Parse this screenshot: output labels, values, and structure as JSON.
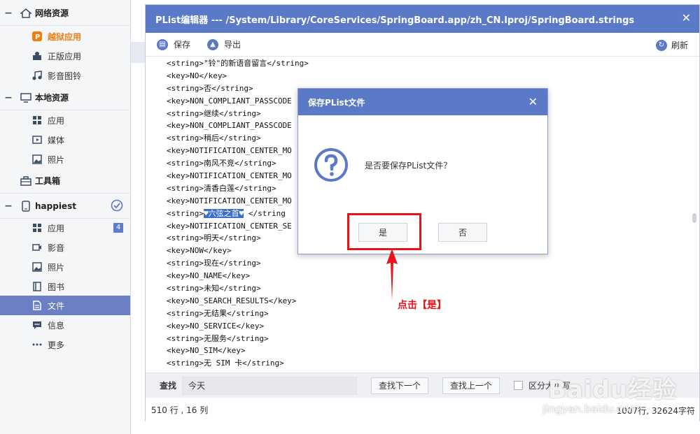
{
  "sidebar": {
    "groups": [
      {
        "label": "网络资源",
        "icon": "home-icon"
      },
      {
        "label": "本地资源",
        "icon": "monitor-icon"
      },
      {
        "label": "工具箱",
        "icon": "toolbox-icon"
      },
      {
        "label": "happiest",
        "icon": "phone-icon"
      }
    ],
    "network_items": [
      {
        "label": "越狱应用",
        "icon": "jailbreak-app-icon"
      },
      {
        "label": "正版应用",
        "icon": "genuine-app-icon"
      },
      {
        "label": "影音图铃",
        "icon": "music-icon"
      }
    ],
    "local_items": [
      {
        "label": "应用",
        "icon": "apps-grid-icon"
      },
      {
        "label": "媒体",
        "icon": "media-icon"
      },
      {
        "label": "照片",
        "icon": "photo-icon"
      }
    ],
    "device_items": [
      {
        "label": "应用",
        "icon": "apps-grid-icon",
        "badge": "4"
      },
      {
        "label": "影音",
        "icon": "video-icon"
      },
      {
        "label": "照片",
        "icon": "photo-icon"
      },
      {
        "label": "图书",
        "icon": "book-icon"
      },
      {
        "label": "文件",
        "icon": "file-icon"
      },
      {
        "label": "信息",
        "icon": "message-icon"
      },
      {
        "label": "更多",
        "icon": "more-icon"
      }
    ]
  },
  "editor": {
    "title": "PList编辑器 --- /System/Library/CoreServices/SpringBoard.app/zh_CN.lproj/SpringBoard.strings",
    "toolbar": {
      "save": "保存",
      "export": "导出",
      "refresh": "刷新"
    },
    "lines": [
      "<string>\"铃\"的新语音留言</string>",
      "<key>NO</key>",
      "<string>否</string>",
      "<key>NON_COMPLIANT_PASSCODE",
      "<string>继续</string>",
      "<key>NON_COMPLIANT_PASSCODE",
      "<string>稍后</string>",
      "<key>NOTIFICATION_CENTER_MO",
      "<string>南风不竞</string>",
      "<key>NOTIFICATION_CENTER_MO",
      "<string>清香白莲</string>",
      "<key>NOTIFICATION_CENTER_MO",
      "<key>NOTIFICATION_CENTER_SE",
      "<string>明天</string>",
      "<key>NOW</key>",
      "<string>现在</string>",
      "<key>NO_NAME</key>",
      "<string>未知</string>",
      "<key>NO_SEARCH_RESULTS</key>",
      "<string>无结果</string>",
      "<key>NO_SERVICE</key>",
      "<string>无服务</string>",
      "<key>NO_SIM</key>",
      "<string>无 SIM 卡</string>"
    ],
    "highlight_line": {
      "prefix": "<string>",
      "selected": "♥六弦之首♥",
      "suffix": " </string"
    },
    "find": {
      "label": "查找",
      "value": "今天",
      "next": "查找下一个",
      "prev": "查找上一个",
      "case": "区分大小写"
    },
    "status": {
      "position": "510 行 , 16 列",
      "stats": "1007行, 32624字符"
    }
  },
  "dialog": {
    "title": "保存PList文件",
    "message": "是否要保存PList文件？",
    "yes": "是",
    "no": "否"
  },
  "annotation": {
    "text": "点击【是】",
    "color": "#e8141a"
  },
  "watermark": {
    "main": "Baidu经验",
    "sub": "jingyan.baidu.com"
  },
  "colors": {
    "accent": "#5a79c6",
    "active_nav": "#6c7ec4",
    "orange": "#f07d12"
  }
}
